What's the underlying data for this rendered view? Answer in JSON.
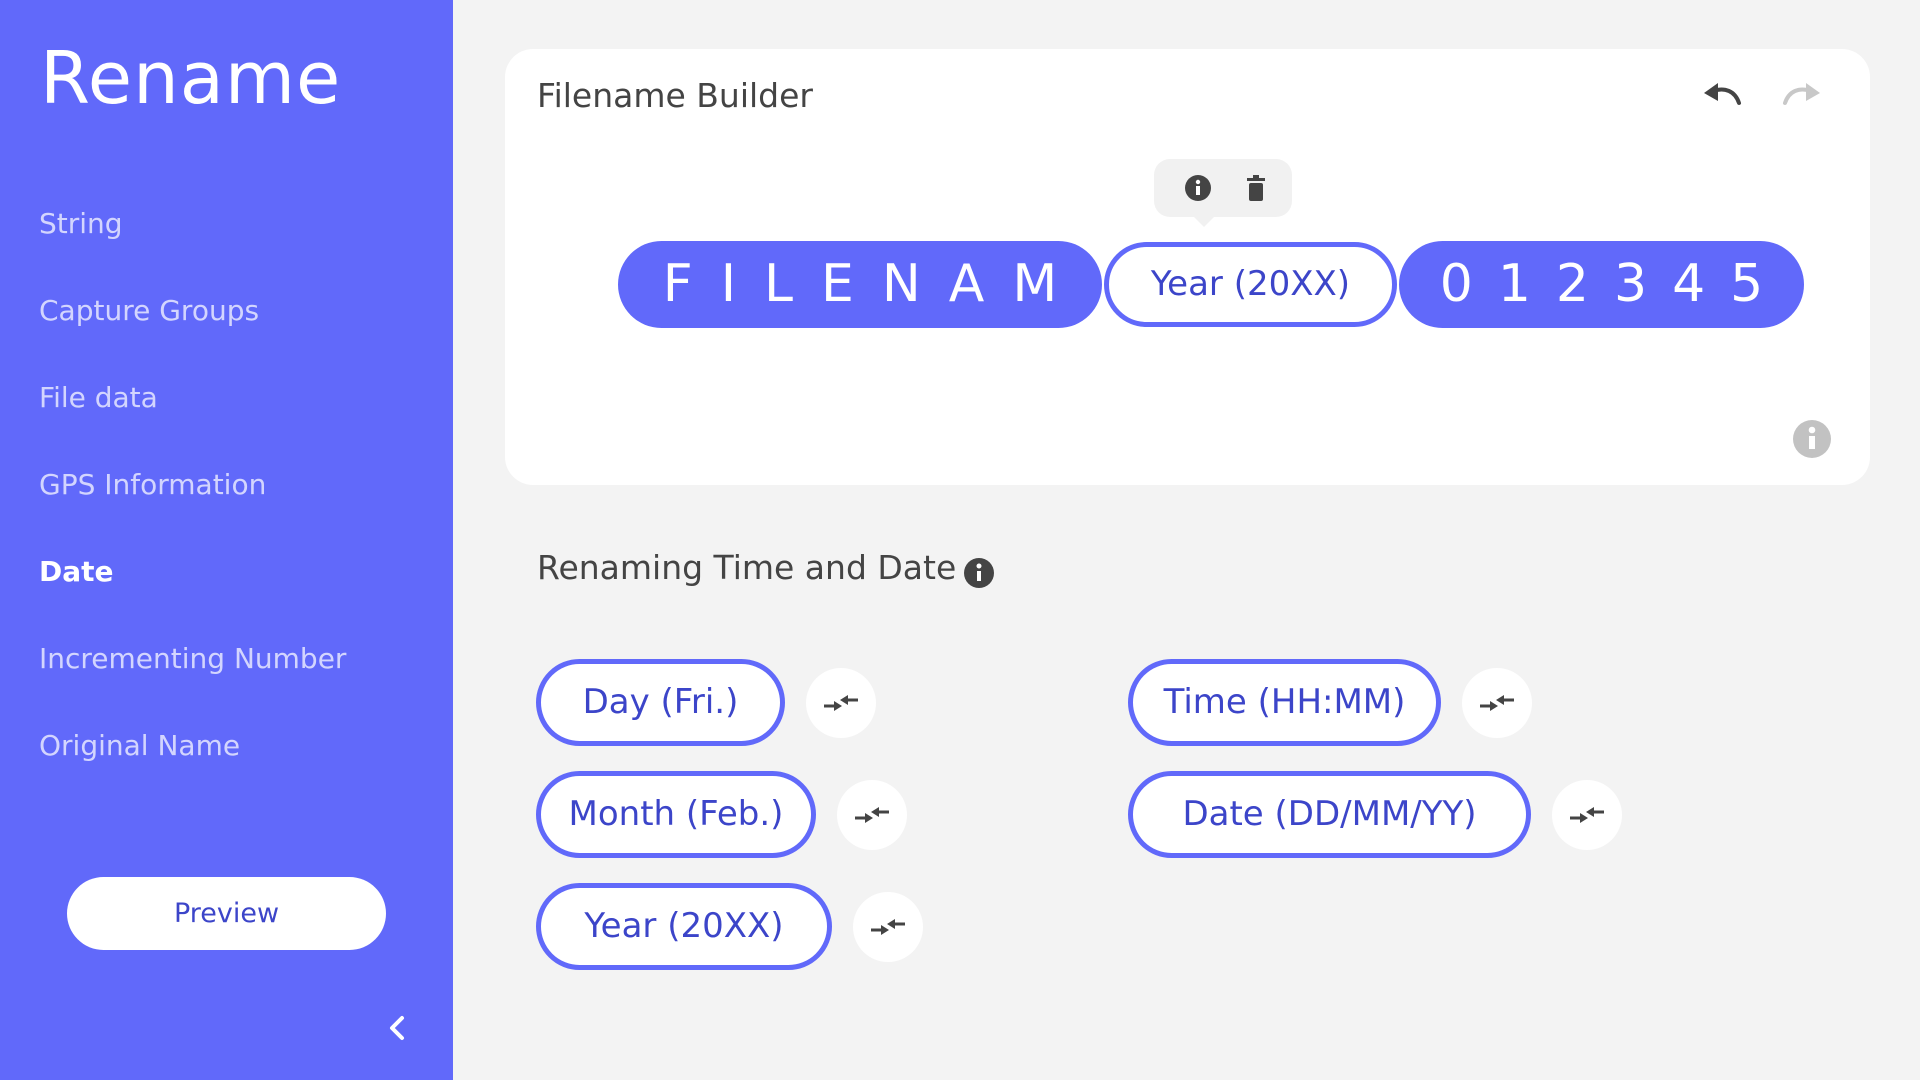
{
  "app": {
    "title": "Rename"
  },
  "sidebar": {
    "items": [
      {
        "label": "String"
      },
      {
        "label": "Capture Groups"
      },
      {
        "label": "File data"
      },
      {
        "label": "GPS Information"
      },
      {
        "label": "Date",
        "active": true
      },
      {
        "label": "Incrementing Number"
      },
      {
        "label": "Original Name"
      }
    ],
    "preview_label": "Preview",
    "collapse_icon": "chevron-left-icon"
  },
  "builder": {
    "title": "Filename Builder",
    "undo_icon": "undo-icon",
    "redo_icon": "redo-icon",
    "tooltip_icons": [
      "info-icon",
      "trash-icon"
    ],
    "chips": [
      {
        "type": "string",
        "text": "FILENAM"
      },
      {
        "type": "date",
        "text": "Year (20XX)"
      },
      {
        "type": "number",
        "text": "012345"
      }
    ]
  },
  "date_section": {
    "title": "Renaming Time and Date",
    "tokens": {
      "day": "Day (Fri.)",
      "month": "Month (Feb.)",
      "year": "Year (20XX)",
      "time": "Time (HH:MM)",
      "date": "Date (DD/MM/YY)"
    },
    "swap_icon": "swap-icon"
  },
  "colors": {
    "accent": "#6169fa",
    "accent_text": "#3c45c9",
    "background": "#f3f3f3",
    "card": "#ffffff"
  }
}
